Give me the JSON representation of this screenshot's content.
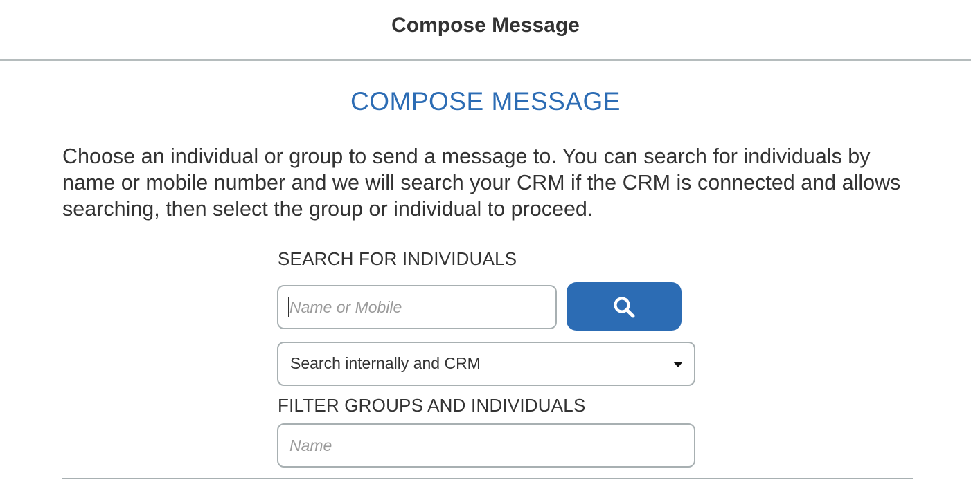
{
  "header": {
    "title": "Compose Message"
  },
  "main": {
    "heading": "COMPOSE MESSAGE",
    "intro": "Choose an individual or group to send a message to. You can search for individuals by name or mobile number and we will search your CRM if the CRM is connected and allows searching, then select the group or individual to proceed.",
    "search": {
      "label": "SEARCH FOR INDIVIDUALS",
      "placeholder": "Name or Mobile",
      "value": "",
      "button_icon": "search-icon",
      "scope_selected": "Search internally and CRM"
    },
    "filter": {
      "label": "FILTER GROUPS AND INDIVIDUALS",
      "placeholder": "Name",
      "value": ""
    }
  },
  "colors": {
    "accent": "#2c6cb4",
    "text": "#333333",
    "border": "#a8b0b2"
  }
}
